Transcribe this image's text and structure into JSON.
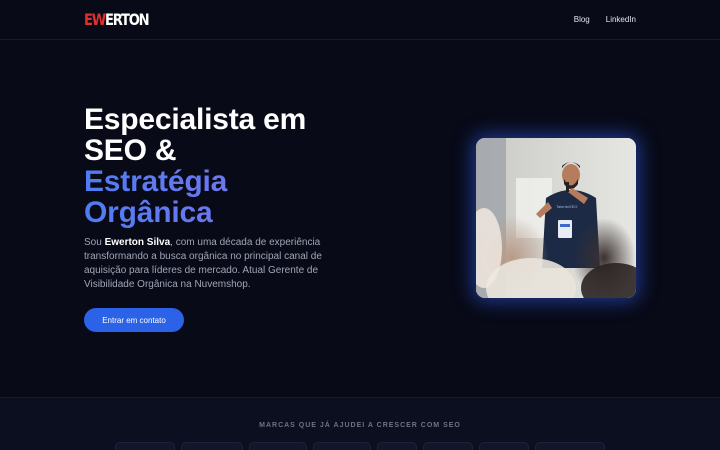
{
  "header": {
    "logo_left": "EW",
    "logo_right": "ERTON",
    "nav": [
      {
        "label": "Blog"
      },
      {
        "label": "LinkedIn"
      }
    ]
  },
  "hero": {
    "title_line1": "Especialista em",
    "title_line2": "SEO &",
    "title_accent1": "Estratégia",
    "title_accent2": "Orgânica",
    "desc_prefix": "Sou ",
    "desc_name": "Ewerton Silva",
    "desc_rest": ", com uma década de experiência transformando a busca orgânica no principal canal de aquisição para líderes de mercado. Atual Gerente de Visibilidade Orgânica na Nuvemshop.",
    "cta_label": "Entrar em contato"
  },
  "brands": {
    "title": "MARCAS QUE JÁ AJUDEI A CRESCER COM SEO"
  },
  "colors": {
    "background": "#080a17",
    "accent_blue": "#2b62e8",
    "logo_red": "#e2302c",
    "gradient_start": "#4f7cf3",
    "gradient_end": "#8e72ea"
  }
}
